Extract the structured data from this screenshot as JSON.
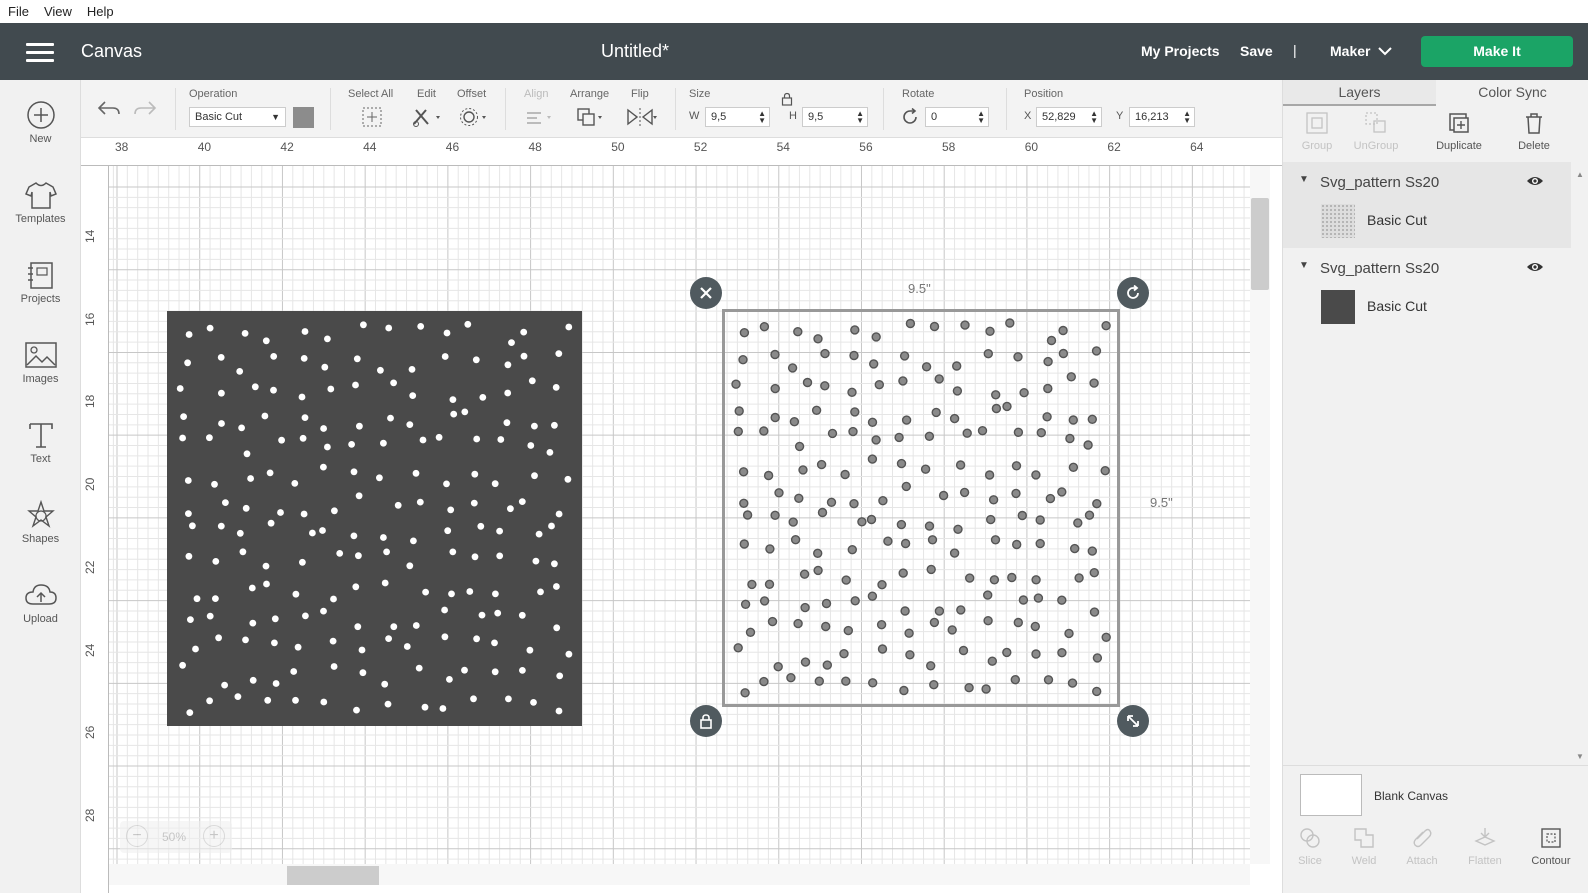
{
  "menubar": {
    "items": [
      "File",
      "View",
      "Help"
    ]
  },
  "header": {
    "app_title": "Canvas",
    "doc_title": "Untitled*",
    "my_projects": "My Projects",
    "save": "Save",
    "separator": "|",
    "machine": "Maker",
    "make_it": "Make It"
  },
  "sidebar": {
    "items": [
      {
        "label": "New",
        "icon": "plus-circle-icon"
      },
      {
        "label": "Templates",
        "icon": "tshirt-icon"
      },
      {
        "label": "Projects",
        "icon": "projects-icon"
      },
      {
        "label": "Images",
        "icon": "image-icon"
      },
      {
        "label": "Text",
        "icon": "text-icon"
      },
      {
        "label": "Shapes",
        "icon": "shapes-icon"
      },
      {
        "label": "Upload",
        "icon": "upload-cloud-icon"
      }
    ]
  },
  "toolbar": {
    "operation_label": "Operation",
    "operation_value": "Basic Cut",
    "operation_color": "#8c8c8c",
    "select_all": "Select All",
    "edit": "Edit",
    "offset": "Offset",
    "align": "Align",
    "arrange": "Arrange",
    "flip": "Flip",
    "size": "Size",
    "w_label": "W",
    "w_value": "9,5",
    "h_label": "H",
    "h_value": "9,5",
    "rotate": "Rotate",
    "rotate_value": "0",
    "position": "Position",
    "x_label": "X",
    "x_value": "52,829",
    "y_label": "Y",
    "y_value": "16,213"
  },
  "canvas": {
    "ruler_h": [
      "38",
      "40",
      "42",
      "44",
      "46",
      "48",
      "50",
      "52",
      "54",
      "56",
      "58",
      "60",
      "62",
      "64"
    ],
    "ruler_v": [
      "14",
      "16",
      "18",
      "20",
      "22",
      "24",
      "26",
      "28"
    ],
    "width_label": "9.5\"",
    "height_label": "9.5\"",
    "zoom_value": "50%",
    "zoom_minus": "−",
    "zoom_plus": "+",
    "dark_fill": "#4a4a4a",
    "dot_fill": "#8a8a8a"
  },
  "panel": {
    "tabs": [
      "Layers",
      "Color Sync"
    ],
    "actions": [
      "Group",
      "UnGroup",
      "Duplicate",
      "Delete"
    ],
    "layers": [
      {
        "name": "Svg_pattern Ss20",
        "child": "Basic Cut"
      },
      {
        "name": "Svg_pattern Ss20",
        "child": "Basic Cut"
      }
    ],
    "blank_canvas": "Blank Canvas",
    "bottom_actions": [
      "Slice",
      "Weld",
      "Attach",
      "Flatten",
      "Contour"
    ]
  }
}
